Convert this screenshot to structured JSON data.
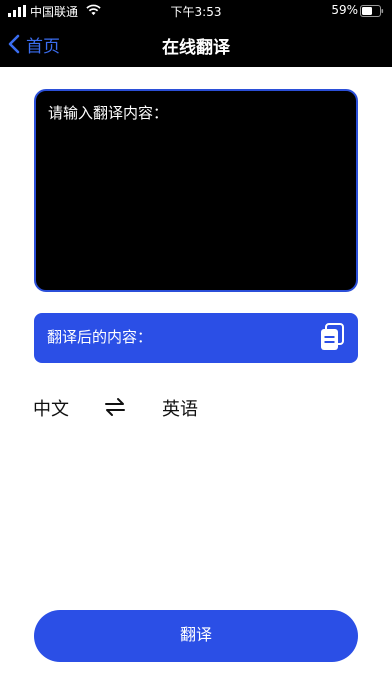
{
  "status_bar": {
    "carrier": "中国联通",
    "time": "下午3:53",
    "battery_percent": "59%",
    "battery_level": 0.59
  },
  "nav": {
    "back_label": "首页",
    "title": "在线翻译"
  },
  "input": {
    "placeholder": "请输入翻译内容："
  },
  "result": {
    "label": "翻译后的内容：",
    "copy_icon": "copy-icon"
  },
  "languages": {
    "source": "中文",
    "target": "英语",
    "swap_icon": "swap-arrows-icon"
  },
  "actions": {
    "translate_label": "翻译"
  },
  "colors": {
    "accent": "#2b4fe6",
    "back_link": "#3a6df0",
    "nav_bg": "#000000"
  }
}
